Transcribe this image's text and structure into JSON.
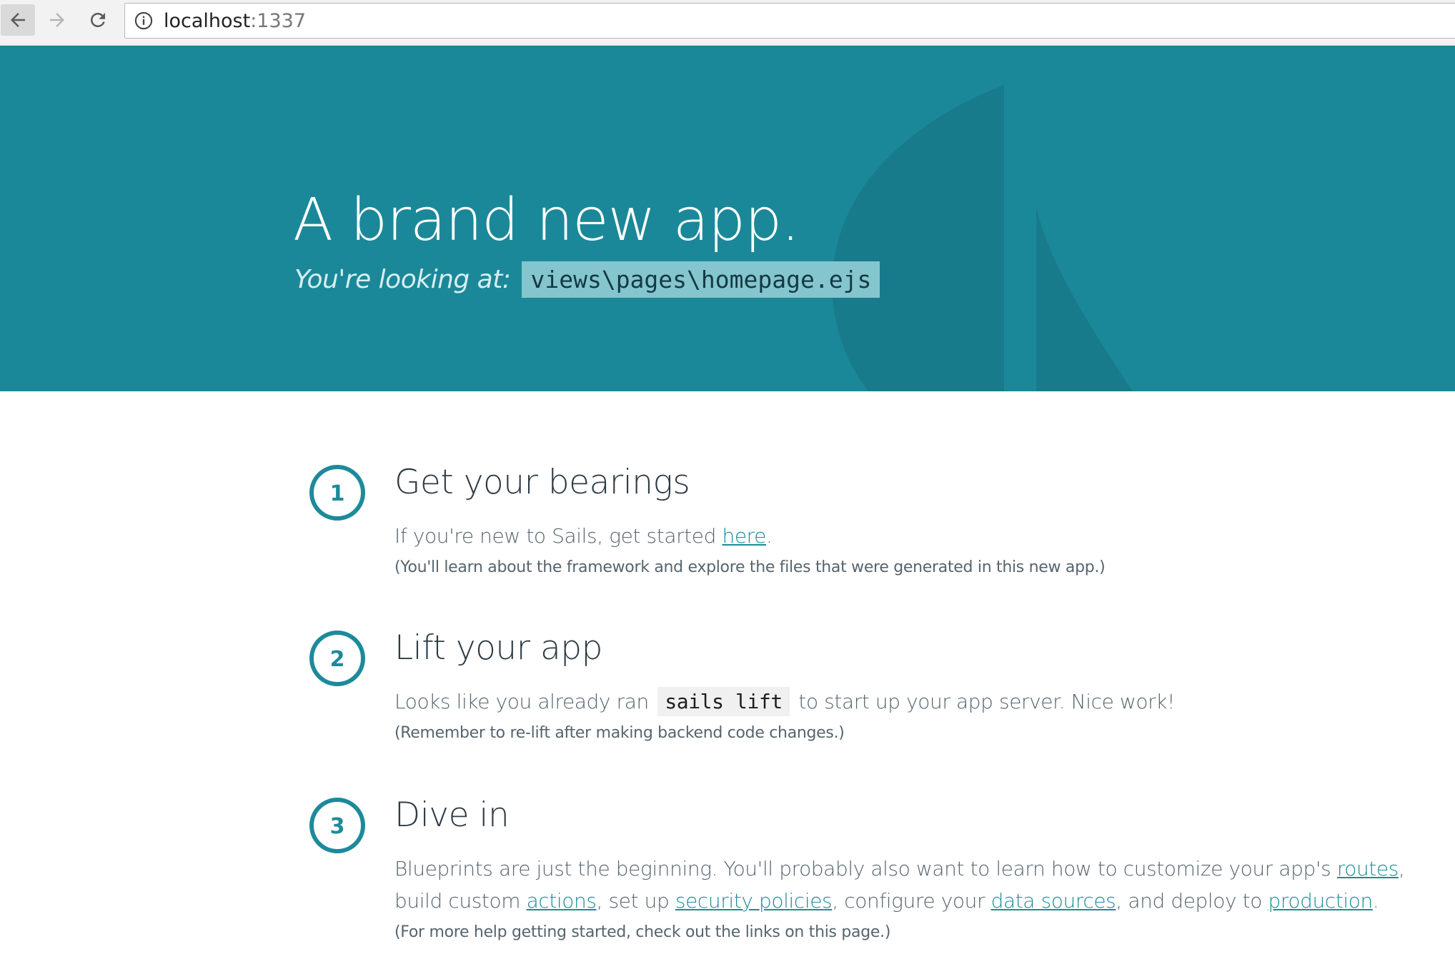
{
  "browser": {
    "url_host": "localhost",
    "url_port": ":1337"
  },
  "hero": {
    "title": "A brand new app.",
    "subtitle_lead": "You're looking at:",
    "subtitle_path": "views\\pages\\homepage.ejs"
  },
  "steps": [
    {
      "number": "1",
      "title": "Get your bearings",
      "text_before": "If you're new to Sails, get started ",
      "link_here": "here",
      "text_after": ".",
      "note": "(You'll learn about the framework and explore the files that were generated in this new app.)"
    },
    {
      "number": "2",
      "title": "Lift your app",
      "text_before": "Looks like you already ran ",
      "code": "sails lift",
      "text_after": " to start up your app server. Nice work!",
      "note": "(Remember to re-lift after making backend code changes.)"
    },
    {
      "number": "3",
      "title": "Dive in",
      "text_1": "Blueprints are just the beginning. You'll probably also want to learn how to customize your app's ",
      "link_routes": "routes",
      "text_2": ", build custom ",
      "link_actions": "actions",
      "text_3": ", set up ",
      "link_security": "security policies",
      "text_4": ", configure your ",
      "link_data": "data sources",
      "text_5": ", and deploy to ",
      "link_production": "production",
      "text_6": ".",
      "note": "(For more help getting started, check out the links on this page.)"
    }
  ],
  "colors": {
    "hero_background": "#1b8899",
    "accent": "#1d8a9b",
    "code_background": "#85c5cd"
  }
}
